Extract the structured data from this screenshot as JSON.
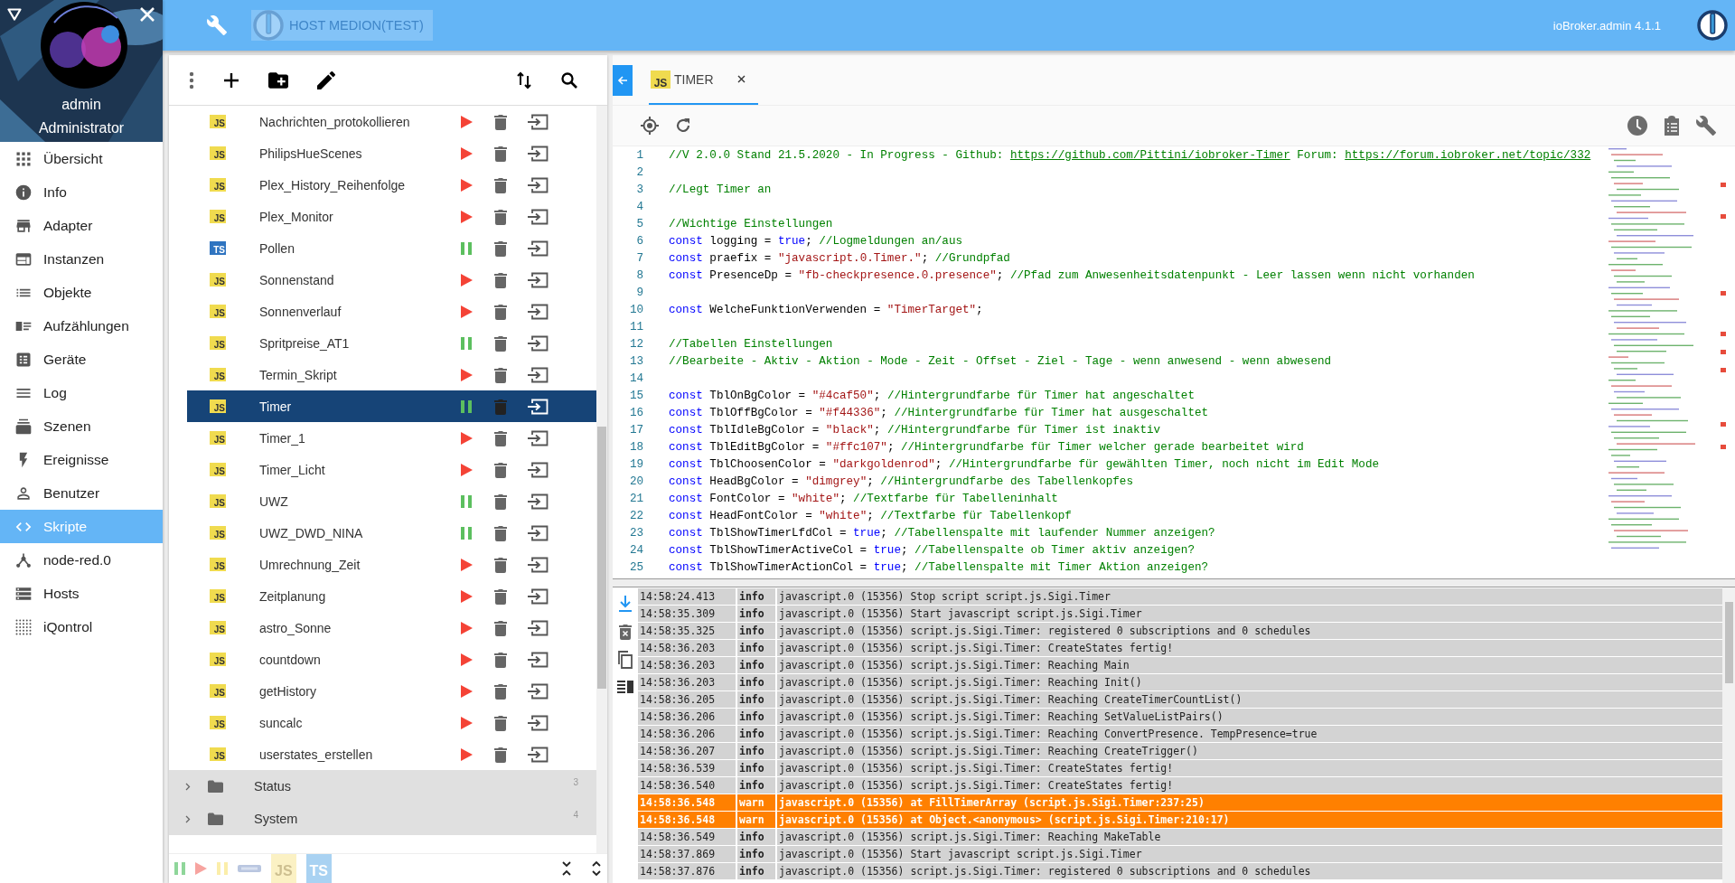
{
  "sidebar": {
    "user": "admin",
    "role": "Administrator",
    "items": [
      {
        "label": "Übersicht",
        "kind": "overview",
        "selected": false
      },
      {
        "label": "Info",
        "kind": "info",
        "selected": false
      },
      {
        "label": "Adapter",
        "kind": "adapter",
        "selected": false
      },
      {
        "label": "Instanzen",
        "kind": "instances",
        "selected": false
      },
      {
        "label": "Objekte",
        "kind": "objects",
        "selected": false
      },
      {
        "label": "Aufzählungen",
        "kind": "enums",
        "selected": false
      },
      {
        "label": "Geräte",
        "kind": "devices",
        "selected": false
      },
      {
        "label": "Log",
        "kind": "log",
        "selected": false
      },
      {
        "label": "Szenen",
        "kind": "scenes",
        "selected": false
      },
      {
        "label": "Ereignisse",
        "kind": "events",
        "selected": false
      },
      {
        "label": "Benutzer",
        "kind": "users",
        "selected": false
      },
      {
        "label": "Skripte",
        "kind": "scripts",
        "selected": true
      },
      {
        "label": "node-red.0",
        "kind": "nodered",
        "selected": false
      },
      {
        "label": "Hosts",
        "kind": "hosts",
        "selected": false
      },
      {
        "label": "iQontrol",
        "kind": "iqontrol",
        "selected": false
      }
    ]
  },
  "topbar": {
    "host": "HOST MEDION(TEST)",
    "version": "ioBroker.admin 4.1.1"
  },
  "scripts": {
    "items": [
      {
        "name": "Nachrichten_protokollieren",
        "kind": "js",
        "badge": "JS",
        "running": false,
        "selected": false
      },
      {
        "name": "PhilipsHueScenes",
        "kind": "js",
        "badge": "JS",
        "running": false,
        "selected": false
      },
      {
        "name": "Plex_History_Reihenfolge",
        "kind": "js",
        "badge": "JS",
        "running": false,
        "selected": false
      },
      {
        "name": "Plex_Monitor",
        "kind": "js",
        "badge": "JS",
        "running": false,
        "selected": false
      },
      {
        "name": "Pollen",
        "kind": "ts",
        "badge": "TS",
        "running": true,
        "selected": false
      },
      {
        "name": "Sonnenstand",
        "kind": "js",
        "badge": "JS",
        "running": false,
        "selected": false
      },
      {
        "name": "Sonnenverlauf",
        "kind": "js",
        "badge": "JS",
        "running": false,
        "selected": false
      },
      {
        "name": "Spritpreise_AT1",
        "kind": "js",
        "badge": "JS",
        "running": true,
        "selected": false
      },
      {
        "name": "Termin_Skript",
        "kind": "js",
        "badge": "JS",
        "running": false,
        "selected": false
      },
      {
        "name": "Timer",
        "kind": "js",
        "badge": "JS",
        "running": true,
        "selected": true
      },
      {
        "name": "Timer_1",
        "kind": "js",
        "badge": "JS",
        "running": false,
        "selected": false
      },
      {
        "name": "Timer_Licht",
        "kind": "js",
        "badge": "JS",
        "running": false,
        "selected": false
      },
      {
        "name": "UWZ",
        "kind": "js",
        "badge": "JS",
        "running": true,
        "selected": false
      },
      {
        "name": "UWZ_DWD_NINA",
        "kind": "js",
        "badge": "JS",
        "running": true,
        "selected": false
      },
      {
        "name": "Umrechnung_Zeit",
        "kind": "js",
        "badge": "JS",
        "running": false,
        "selected": false
      },
      {
        "name": "Zeitplanung",
        "kind": "js",
        "badge": "JS",
        "running": false,
        "selected": false
      },
      {
        "name": "astro_Sonne",
        "kind": "js",
        "badge": "JS",
        "running": false,
        "selected": false
      },
      {
        "name": "countdown",
        "kind": "js",
        "badge": "JS",
        "running": false,
        "selected": false
      },
      {
        "name": "getHistory",
        "kind": "js",
        "badge": "JS",
        "running": false,
        "selected": false
      },
      {
        "name": "suncalc",
        "kind": "js",
        "badge": "JS",
        "running": false,
        "selected": false
      },
      {
        "name": "userstates_erstellen",
        "kind": "js",
        "badge": "JS",
        "running": false,
        "selected": false
      }
    ],
    "folders": [
      {
        "name": "Status",
        "count": "3"
      },
      {
        "name": "System",
        "count": "4"
      }
    ],
    "filters": [
      {
        "kind": "running"
      },
      {
        "kind": "stopped"
      },
      {
        "kind": "paused"
      },
      {
        "kind": "blockly"
      },
      {
        "kind": "js",
        "label": "JS"
      },
      {
        "kind": "ts",
        "label": "TS"
      }
    ]
  },
  "editor": {
    "tabs": [
      {
        "badge": "JS",
        "label": "TIMER",
        "selected": true
      }
    ],
    "lines": [
      {
        "number": "1",
        "tokens": [
          {
            "kind": "comment",
            "text": "//V 2.0.0 Stand 21.5.2020 - In Progress - Github: "
          },
          {
            "kind": "link",
            "text": "https://github.com/Pittini/iobroker-Timer"
          },
          {
            "kind": "comment",
            "text": " Forum: "
          },
          {
            "kind": "link",
            "text": "https://forum.iobroker.net/topic/332"
          }
        ]
      },
      {
        "number": "2"
      },
      {
        "number": "3",
        "tokens": [
          {
            "kind": "comment",
            "text": "//Legt Timer an"
          }
        ]
      },
      {
        "number": "4"
      },
      {
        "number": "5",
        "tokens": [
          {
            "kind": "comment",
            "text": "//Wichtige Einstellungen"
          }
        ]
      },
      {
        "number": "6",
        "tokens": [
          {
            "kind": "keyword",
            "text": "const"
          },
          {
            "kind": "plain",
            "text": " logging = "
          },
          {
            "kind": "keyword",
            "text": "true"
          },
          {
            "kind": "plain",
            "text": "; "
          },
          {
            "kind": "comment",
            "text": "//Logmeldungen an/aus"
          }
        ]
      },
      {
        "number": "7",
        "tokens": [
          {
            "kind": "keyword",
            "text": "const"
          },
          {
            "kind": "plain",
            "text": " praefix = "
          },
          {
            "kind": "string",
            "text": "\"javascript.0.Timer.\""
          },
          {
            "kind": "plain",
            "text": "; "
          },
          {
            "kind": "comment",
            "text": "//Grundpfad"
          }
        ]
      },
      {
        "number": "8",
        "tokens": [
          {
            "kind": "keyword",
            "text": "const"
          },
          {
            "kind": "plain",
            "text": " PresenceDp = "
          },
          {
            "kind": "string",
            "text": "\"fb-checkpresence.0.presence\""
          },
          {
            "kind": "plain",
            "text": "; "
          },
          {
            "kind": "comment",
            "text": "//Pfad zum Anwesenheitsdatenpunkt - Leer lassen wenn nicht vorhanden"
          }
        ]
      },
      {
        "number": "9"
      },
      {
        "number": "10",
        "tokens": [
          {
            "kind": "keyword",
            "text": "const"
          },
          {
            "kind": "plain",
            "text": " WelcheFunktionVerwenden = "
          },
          {
            "kind": "string",
            "text": "\"TimerTarget\""
          },
          {
            "kind": "plain",
            "text": ";"
          }
        ]
      },
      {
        "number": "11"
      },
      {
        "number": "12",
        "tokens": [
          {
            "kind": "comment",
            "text": "//Tabellen Einstellungen"
          }
        ]
      },
      {
        "number": "13",
        "tokens": [
          {
            "kind": "comment",
            "text": "//Bearbeite - Aktiv - Aktion - Mode - Zeit - Offset - Ziel - Tage - wenn anwesend - wenn abwesend"
          }
        ]
      },
      {
        "number": "14"
      },
      {
        "number": "15",
        "tokens": [
          {
            "kind": "keyword",
            "text": "const"
          },
          {
            "kind": "plain",
            "text": " TblOnBgColor = "
          },
          {
            "kind": "string",
            "text": "\"#4caf50\""
          },
          {
            "kind": "plain",
            "text": "; "
          },
          {
            "kind": "comment",
            "text": "//Hintergrundfarbe für Timer hat angeschaltet"
          }
        ]
      },
      {
        "number": "16",
        "tokens": [
          {
            "kind": "keyword",
            "text": "const"
          },
          {
            "kind": "plain",
            "text": " TblOffBgColor = "
          },
          {
            "kind": "string",
            "text": "\"#f44336\""
          },
          {
            "kind": "plain",
            "text": "; "
          },
          {
            "kind": "comment",
            "text": "//Hintergrundfarbe für Timer hat ausgeschaltet"
          }
        ]
      },
      {
        "number": "17",
        "tokens": [
          {
            "kind": "keyword",
            "text": "const"
          },
          {
            "kind": "plain",
            "text": " TblIdleBgColor = "
          },
          {
            "kind": "string",
            "text": "\"black\""
          },
          {
            "kind": "plain",
            "text": "; "
          },
          {
            "kind": "comment",
            "text": "//Hintergrundfarbe für Timer ist inaktiv"
          }
        ]
      },
      {
        "number": "18",
        "tokens": [
          {
            "kind": "keyword",
            "text": "const"
          },
          {
            "kind": "plain",
            "text": " TblEditBgColor = "
          },
          {
            "kind": "string",
            "text": "\"#ffc107\""
          },
          {
            "kind": "plain",
            "text": "; "
          },
          {
            "kind": "comment",
            "text": "//Hintergrundfarbe für Timer welcher gerade bearbeitet wird"
          }
        ]
      },
      {
        "number": "19",
        "tokens": [
          {
            "kind": "keyword",
            "text": "const"
          },
          {
            "kind": "plain",
            "text": " TblChoosenColor = "
          },
          {
            "kind": "string",
            "text": "\"darkgoldenrod\""
          },
          {
            "kind": "plain",
            "text": "; "
          },
          {
            "kind": "comment",
            "text": "//Hintergrundfarbe für gewählten Timer, noch nicht im Edit Mode"
          }
        ]
      },
      {
        "number": "20",
        "tokens": [
          {
            "kind": "keyword",
            "text": "const"
          },
          {
            "kind": "plain",
            "text": " HeadBgColor = "
          },
          {
            "kind": "string",
            "text": "\"dimgrey\""
          },
          {
            "kind": "plain",
            "text": "; "
          },
          {
            "kind": "comment",
            "text": "//Hintergrundfarbe des Tabellenkopfes"
          }
        ]
      },
      {
        "number": "21",
        "tokens": [
          {
            "kind": "keyword",
            "text": "const"
          },
          {
            "kind": "plain",
            "text": " FontColor = "
          },
          {
            "kind": "string",
            "text": "\"white\""
          },
          {
            "kind": "plain",
            "text": "; "
          },
          {
            "kind": "comment",
            "text": "//Textfarbe für Tabelleninhalt"
          }
        ]
      },
      {
        "number": "22",
        "tokens": [
          {
            "kind": "keyword",
            "text": "const"
          },
          {
            "kind": "plain",
            "text": " HeadFontColor = "
          },
          {
            "kind": "string",
            "text": "\"white\""
          },
          {
            "kind": "plain",
            "text": "; "
          },
          {
            "kind": "comment",
            "text": "//Textfarbe für Tabellenkopf"
          }
        ]
      },
      {
        "number": "23",
        "tokens": [
          {
            "kind": "keyword",
            "text": "const"
          },
          {
            "kind": "plain",
            "text": " TblShowTimerLfdCol = "
          },
          {
            "kind": "keyword",
            "text": "true"
          },
          {
            "kind": "plain",
            "text": "; "
          },
          {
            "kind": "comment",
            "text": "//Tabellenspalte mit laufender Nummer anzeigen?"
          }
        ]
      },
      {
        "number": "24",
        "tokens": [
          {
            "kind": "keyword",
            "text": "const"
          },
          {
            "kind": "plain",
            "text": " TblShowTimerActiveCol = "
          },
          {
            "kind": "keyword",
            "text": "true"
          },
          {
            "kind": "plain",
            "text": "; "
          },
          {
            "kind": "comment",
            "text": "//Tabellenspalte ob Timer aktiv anzeigen?"
          }
        ]
      },
      {
        "number": "25",
        "tokens": [
          {
            "kind": "keyword",
            "text": "const"
          },
          {
            "kind": "plain",
            "text": " TblShowTimerActionCol = "
          },
          {
            "kind": "keyword",
            "text": "true"
          },
          {
            "kind": "plain",
            "text": "; "
          },
          {
            "kind": "comment",
            "text": "//Tabellenspalte mit Timer Aktion anzeigen?"
          }
        ]
      }
    ]
  },
  "log": {
    "rows": [
      {
        "time": "14:58:24.413",
        "level": "info",
        "kind": "info",
        "message": "javascript.0 (15356) Stop script script.js.Sigi.Timer"
      },
      {
        "time": "14:58:35.309",
        "level": "info",
        "kind": "info",
        "message": "javascript.0 (15356) Start javascript script.js.Sigi.Timer"
      },
      {
        "time": "14:58:35.325",
        "level": "info",
        "kind": "info",
        "message": "javascript.0 (15356) script.js.Sigi.Timer: registered 0 subscriptions and 0 schedules"
      },
      {
        "time": "14:58:36.203",
        "level": "info",
        "kind": "info",
        "message": "javascript.0 (15356) script.js.Sigi.Timer: CreateStates fertig!"
      },
      {
        "time": "14:58:36.203",
        "level": "info",
        "kind": "info",
        "message": "javascript.0 (15356) script.js.Sigi.Timer: Reaching Main"
      },
      {
        "time": "14:58:36.203",
        "level": "info",
        "kind": "info",
        "message": "javascript.0 (15356) script.js.Sigi.Timer: Reaching Init()"
      },
      {
        "time": "14:58:36.205",
        "level": "info",
        "kind": "info",
        "message": "javascript.0 (15356) script.js.Sigi.Timer: Reaching CreateTimerCountList()"
      },
      {
        "time": "14:58:36.206",
        "level": "info",
        "kind": "info",
        "message": "javascript.0 (15356) script.js.Sigi.Timer: Reaching SetValueListPairs()"
      },
      {
        "time": "14:58:36.206",
        "level": "info",
        "kind": "info",
        "message": "javascript.0 (15356) script.js.Sigi.Timer: Reaching ConvertPresence. TempPresence=true"
      },
      {
        "time": "14:58:36.207",
        "level": "info",
        "kind": "info",
        "message": "javascript.0 (15356) script.js.Sigi.Timer: Reaching CreateTrigger()"
      },
      {
        "time": "14:58:36.539",
        "level": "info",
        "kind": "info",
        "message": "javascript.0 (15356) script.js.Sigi.Timer: CreateStates fertig!"
      },
      {
        "time": "14:58:36.540",
        "level": "info",
        "kind": "info",
        "message": "javascript.0 (15356) script.js.Sigi.Timer: CreateStates fertig!"
      },
      {
        "time": "14:58:36.548",
        "level": "warn",
        "kind": "warn",
        "message": "javascript.0 (15356) at FillTimerArray (script.js.Sigi.Timer:237:25)"
      },
      {
        "time": "14:58:36.548",
        "level": "warn",
        "kind": "warn",
        "message": "javascript.0 (15356) at Object.<anonymous> (script.js.Sigi.Timer:210:17)"
      },
      {
        "time": "14:58:36.549",
        "level": "info",
        "kind": "info",
        "message": "javascript.0 (15356) script.js.Sigi.Timer: Reaching MakeTable"
      },
      {
        "time": "14:58:37.869",
        "level": "info",
        "kind": "info",
        "message": "javascript.0 (15356) Start javascript script.js.Sigi.Timer"
      },
      {
        "time": "14:58:37.876",
        "level": "info",
        "kind": "info",
        "message": "javascript.0 (15356) script.js.Sigi.Timer: registered 0 subscriptions and 0 schedules"
      }
    ]
  }
}
